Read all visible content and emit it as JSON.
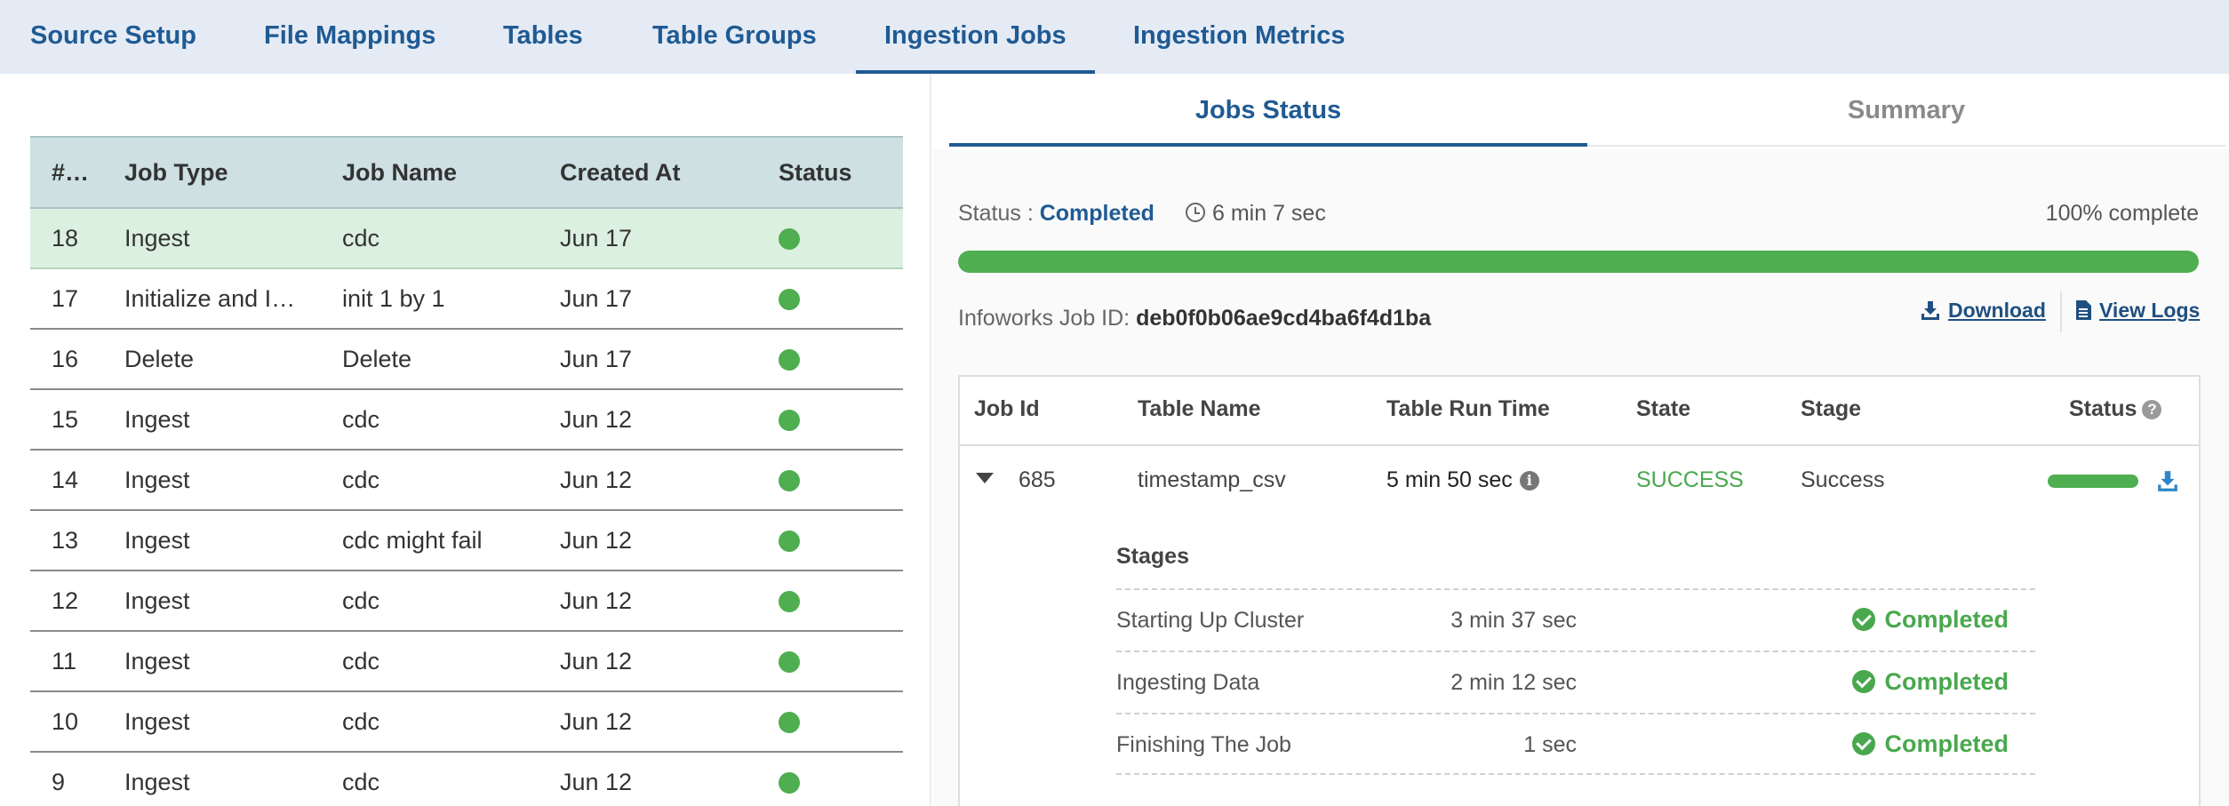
{
  "top_nav": {
    "tabs": [
      {
        "label": "Source Setup"
      },
      {
        "label": "File Mappings"
      },
      {
        "label": "Tables"
      },
      {
        "label": "Table Groups"
      },
      {
        "label": "Ingestion Jobs",
        "active": true
      },
      {
        "label": "Ingestion Metrics"
      }
    ]
  },
  "jobs_table": {
    "columns": [
      "#…",
      "Job Type",
      "Job Name",
      "Created At",
      "Status"
    ],
    "rows": [
      {
        "num": "18",
        "type": "Ingest",
        "name": "cdc",
        "created": "Jun 17",
        "status": "success",
        "selected": true
      },
      {
        "num": "17",
        "type": "Initialize and I…",
        "name": "init 1 by 1",
        "created": "Jun 17",
        "status": "success"
      },
      {
        "num": "16",
        "type": "Delete",
        "name": "Delete",
        "created": "Jun 17",
        "status": "success"
      },
      {
        "num": "15",
        "type": "Ingest",
        "name": "cdc",
        "created": "Jun 12",
        "status": "success"
      },
      {
        "num": "14",
        "type": "Ingest",
        "name": "cdc",
        "created": "Jun 12",
        "status": "success"
      },
      {
        "num": "13",
        "type": "Ingest",
        "name": "cdc might fail",
        "created": "Jun 12",
        "status": "success"
      },
      {
        "num": "12",
        "type": "Ingest",
        "name": "cdc",
        "created": "Jun 12",
        "status": "success"
      },
      {
        "num": "11",
        "type": "Ingest",
        "name": "cdc",
        "created": "Jun 12",
        "status": "success"
      },
      {
        "num": "10",
        "type": "Ingest",
        "name": "cdc",
        "created": "Jun 12",
        "status": "success"
      },
      {
        "num": "9",
        "type": "Ingest",
        "name": "cdc",
        "created": "Jun 12",
        "status": "success"
      }
    ],
    "status_color": "#4eae50"
  },
  "right_tabs": {
    "jobs_status": "Jobs Status",
    "summary": "Summary"
  },
  "job_status": {
    "status_label": "Status : ",
    "status_value": "Completed",
    "duration": "6 min 7 sec",
    "percent_text": "100% complete",
    "progress": 1.0,
    "job_id_label": "Infoworks Job ID: ",
    "job_id": "deb0f0b06ae9cd4ba6f4d1ba",
    "download_label": "Download",
    "view_logs_label": "View Logs"
  },
  "detail_table": {
    "headers": {
      "job_id": "Job Id",
      "table_name": "Table Name",
      "run_time": "Table Run Time",
      "state": "State",
      "stage": "Stage",
      "status": "Status"
    },
    "row": {
      "job_id": "685",
      "table_name": "timestamp_csv",
      "run_time": "5 min 50 sec",
      "state": "SUCCESS",
      "stage": "Success",
      "progress": 1.0
    },
    "stages_title": "Stages",
    "stages": [
      {
        "name": "Starting Up Cluster",
        "time": "3 min 37 sec",
        "status": "Completed"
      },
      {
        "name": "Ingesting Data",
        "time": "2 min 12 sec",
        "status": "Completed"
      },
      {
        "name": "Finishing The Job",
        "time": "1 sec",
        "status": "Completed"
      }
    ]
  },
  "colors": {
    "brand_blue": "#1f5a93",
    "success_green": "#4eae50"
  }
}
